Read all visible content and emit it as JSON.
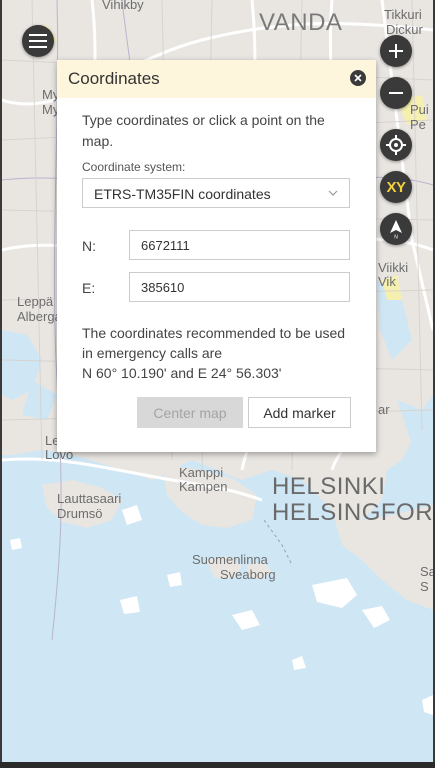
{
  "map": {
    "labels": {
      "vihikby": "Vihikby",
      "vanda": "VANDA",
      "tikkuri": "Tikkuri",
      "dickur": "Dickur",
      "my1": "My",
      "my2": "My",
      "pui": "Pui",
      "pe": "Pe",
      "leppa": "Leppä",
      "alberga": "Alberga",
      "viikki": "Viikki",
      "vik": "Vik",
      "ar": "ar",
      "le": "Le",
      "lovo": "Lovo",
      "lauttasaari": "Lauttasaari",
      "drumso": "Drumsö",
      "kamppi": "Kamppi",
      "kampen": "Kampen",
      "helsinki": "HELSINKI",
      "helsingfors": "HELSINGFOR",
      "suomenlinna": "Suomenlinna",
      "sveaborg": "Sveaborg",
      "sa": "Sa",
      "s": "S"
    },
    "controls": {
      "menu_icon": "hamburger-menu-icon",
      "zoom_in_icon": "plus-icon",
      "zoom_out_icon": "minus-icon",
      "locate_icon": "crosshair-icon",
      "coordinates_label": "XY",
      "north_icon": "compass-north-icon",
      "north_letter": "N"
    },
    "colors": {
      "water": "#cfe6f4",
      "land": "#e9e6e2",
      "roads": "#ffffff",
      "highlight": "#f6f0b0",
      "control_bg": "#3a3a3a",
      "xy_accent": "#f4d23a"
    }
  },
  "panel": {
    "title": "Coordinates",
    "close_icon": "close-icon",
    "intro": "Type coordinates or click a point on the map.",
    "coordinate_system_label": "Coordinate system:",
    "coordinate_system_value": "ETRS-TM35FIN coordinates",
    "fields": {
      "n_label": "N:",
      "n_value": "6672111",
      "e_label": "E:",
      "e_value": "385610"
    },
    "note_line1": "The coordinates recommended to be used",
    "note_line2": "in emergency calls are",
    "note_line3": "N 60° 10.190' and E 24° 56.303'",
    "center_map_label": "Center map",
    "add_marker_label": "Add marker",
    "header_color": "#fdf6dc"
  }
}
